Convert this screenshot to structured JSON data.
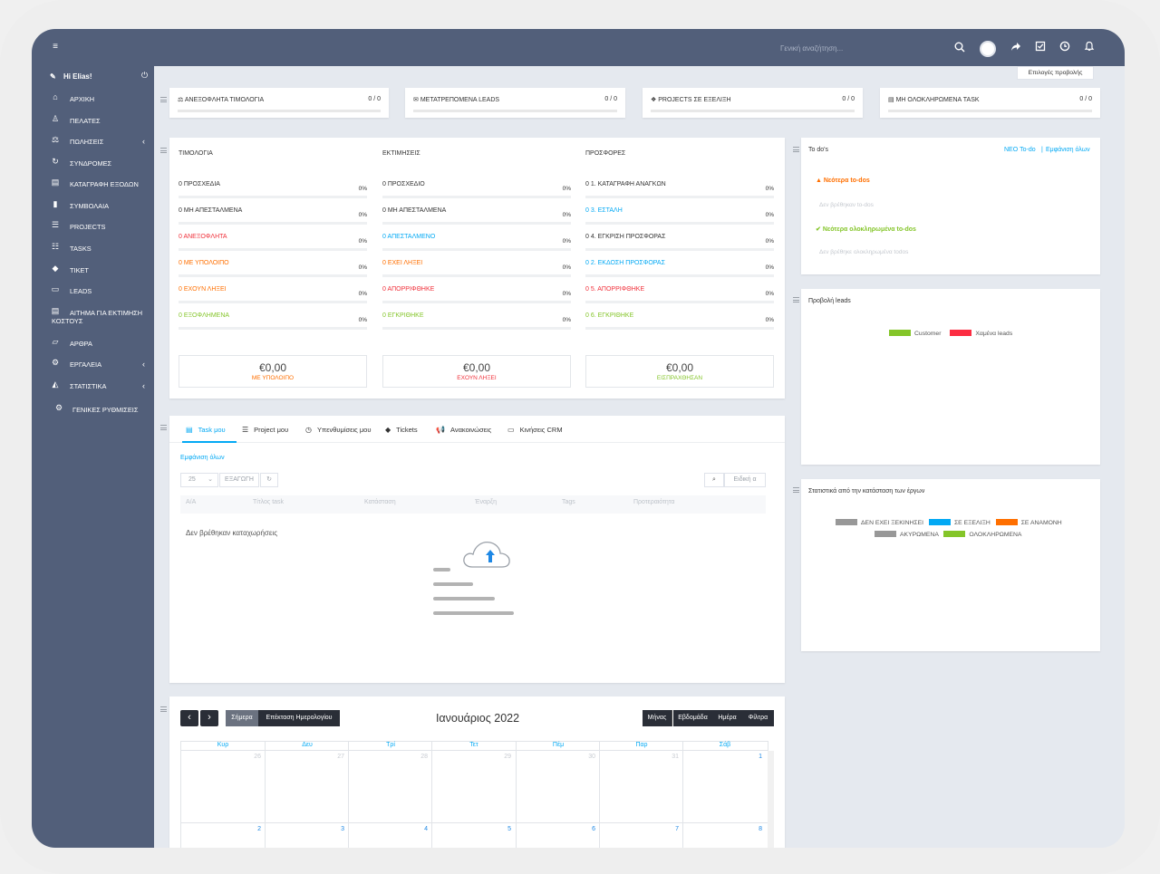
{
  "topbar": {
    "search_placeholder": "Γενική αναζήτηση...",
    "icons": [
      "menu-icon",
      "search-icon",
      "avatar",
      "share-icon",
      "checklist-icon",
      "clock-icon",
      "bell-icon"
    ]
  },
  "sidebar": {
    "greeting": "Hi Elias!",
    "items": [
      {
        "label": "ΑΡΧΙΚΗ",
        "icon": "home-icon"
      },
      {
        "label": "ΠΕΛΑΤΕΣ",
        "icon": "user-icon"
      },
      {
        "label": "ΠΩΛΗΣΕΙΣ",
        "icon": "balance-scale-icon",
        "chevron": true
      },
      {
        "label": "ΣΥΝΔΡΟΜΕΣ",
        "icon": "refresh-icon"
      },
      {
        "label": "ΚΑΤΑΓΡΑΦΗ ΕΞΟΔΩΝ",
        "icon": "file-lines-icon"
      },
      {
        "label": "ΣΥΜΒΟΛΑΙΑ",
        "icon": "file-icon"
      },
      {
        "label": "PROJECTS",
        "icon": "bars-icon"
      },
      {
        "label": "TASKS",
        "icon": "list-icon"
      },
      {
        "label": "ΤΙΚΕΤ",
        "icon": "ticket-icon"
      },
      {
        "label": "LEADS",
        "icon": "tty-icon"
      },
      {
        "label": "ΑΙΤΗΜΑ ΓΙΑ ΕΚΤΙΜΗΣΗ",
        "label2": "ΚΟΣΤΟΥΣ",
        "icon": "file-alt-icon"
      },
      {
        "label": "ΑΡΘΡΑ",
        "icon": "folder-open-icon"
      },
      {
        "label": "ΕΡΓΑΛΕΙΑ",
        "icon": "cogs-icon",
        "chevron": true
      },
      {
        "label": "ΣΤΑΤΙΣΤΙΚΑ",
        "icon": "area-chart-icon",
        "chevron": true
      },
      {
        "label": "ΓΕΝΙΚΕΣ ΡΥΘΜΙΣΕΙΣ",
        "icon": "gear-icon"
      }
    ]
  },
  "view_options_label": "Επιλογές προβολής",
  "stats": [
    {
      "title": "ΑΝΕΞΟΦΛΗΤΑ ΤΙΜΟΛΟΓΙΑ",
      "count": "0 / 0",
      "icon": "balance-scale-icon"
    },
    {
      "title": "ΜΕΤΑΤΡΕΠΟΜΕΝΑ LEADS",
      "count": "0 / 0",
      "icon": "envelope-icon"
    },
    {
      "title": "PROJECTS ΣΕ ΕΞΕΛΙΞΗ",
      "count": "0 / 0",
      "icon": "cubes-icon"
    },
    {
      "title": "ΜΗ ΟΛΟΚΛΗΡΩΜΕΝΑ TASK",
      "count": "0 / 0",
      "icon": "tasks-icon"
    }
  ],
  "finance": {
    "columns": [
      {
        "title": "ΤΙΜΟΛΟΓΙΑ",
        "rows": [
          {
            "label": "0 ΠΡΟΣΧΕΔΙΑ",
            "pct": "0%",
            "color": "gray"
          },
          {
            "label": "0 ΜΗ ΑΠΕΣΤΑΛΜΕΝΑ",
            "pct": "0%",
            "color": "gray"
          },
          {
            "label": "0 ΑΝΕΞΟΦΛΗΤΑ",
            "pct": "0%",
            "color": "red"
          },
          {
            "label": "0 ΜΕ ΥΠΟΛΟΙΠΟ",
            "pct": "0%",
            "color": "orange"
          },
          {
            "label": "0 ΕΧΟΥΝ ΛΗΞΕΙ",
            "pct": "0%",
            "color": "orange"
          },
          {
            "label": "0 ΕΞΟΦΛΗΜΕΝΑ",
            "pct": "0%",
            "color": "green"
          }
        ],
        "total": {
          "value": "€0,00",
          "label": "ΜΕ ΥΠΟΛΟΙΠΟ",
          "color": "orange"
        }
      },
      {
        "title": "ΕΚΤΙΜΗΣΕΙΣ",
        "rows": [
          {
            "label": "0 ΠΡΟΣΧΕΔΙΟ",
            "pct": "0%",
            "color": "gray"
          },
          {
            "label": "0 ΜΗ ΑΠΕΣΤΑΛΜΕΝΑ",
            "pct": "0%",
            "color": "gray"
          },
          {
            "label": "0 ΑΠΕΣΤΑΛΜΕΝΟ",
            "pct": "0%",
            "color": "blue"
          },
          {
            "label": "0 ΕΧΕΙ ΛΗΞΕΙ",
            "pct": "0%",
            "color": "orange"
          },
          {
            "label": "0 ΑΠΟΡΡΙΦΘΗΚΕ",
            "pct": "0%",
            "color": "red"
          },
          {
            "label": "0 ΕΓΚΡΙΘΗΚΕ",
            "pct": "0%",
            "color": "green"
          }
        ],
        "total": {
          "value": "€0,00",
          "label": "ΕΧΟΥΝ ΛΗΞΕΙ",
          "color": "red"
        }
      },
      {
        "title": "ΠΡΟΣΦΟΡΕΣ",
        "rows": [
          {
            "label": "0 1. ΚΑΤΑΓΡΑΦΗ ΑΝΑΓΚΩΝ",
            "pct": "0%",
            "color": "gray"
          },
          {
            "label": "0 3. ΕΣΤΑΛΗ",
            "pct": "0%",
            "color": "blue"
          },
          {
            "label": "0 4. ΕΓΚΡΙΣΗ ΠΡΟΣΦΟΡΑΣ",
            "pct": "0%",
            "color": "gray"
          },
          {
            "label": "0 2. ΕΚΔΟΣΗ ΠΡΟΣΦΟΡΑΣ",
            "pct": "0%",
            "color": "blue"
          },
          {
            "label": "0 5. ΑΠΟΡΡΙΦΘΗΚΕ",
            "pct": "0%",
            "color": "red"
          },
          {
            "label": "0 6. ΕΓΚΡΙΘΗΚΕ",
            "pct": "0%",
            "color": "green"
          }
        ],
        "total": {
          "value": "€0,00",
          "label": "ΕΙΣΠΡΑΧΘΗΣΑΝ",
          "color": "green"
        }
      }
    ]
  },
  "todos": {
    "title": "To do's",
    "new_link": "ΝΕΟ To-do",
    "sep": "|",
    "view_all": "Εμφάνιση όλων",
    "latest": "Νεότερα to-dos",
    "none_latest": "Δεν βρέθηκαν to-dos",
    "latest_done": "Νεότερα ολοκληρωμένα to-dos",
    "none_done": "Δεν βρέθηκε ολοκληρωμένα todos"
  },
  "leads_panel": {
    "title": "Προβολή leads",
    "legend": [
      {
        "name": "Customer",
        "color": "#84c529"
      },
      {
        "name": "Χαμένα leads",
        "color": "#fc2d42"
      }
    ]
  },
  "projects_panel": {
    "title": "Στατιστικά από την κατάσταση των έργων",
    "legend": [
      {
        "name": "ΔΕΝ ΕΧΕΙ ΞΕΚΙΝΗΣΕΙ",
        "color": "#989898"
      },
      {
        "name": "ΣΕ ΕΞΕΛΙΞΗ",
        "color": "#03a9f4"
      },
      {
        "name": "ΣΕ ΑΝΑΜΟΝΗ",
        "color": "#ff6f00"
      },
      {
        "name": "ΑΚΥΡΩΜΕΝΑ",
        "color": "#989898"
      },
      {
        "name": "ΟΛΟΚΛΗΡΩΜΕΝΑ",
        "color": "#84c529"
      }
    ]
  },
  "tasks_panel": {
    "tabs": [
      {
        "label": "Task μου",
        "icon": "tasks-icon"
      },
      {
        "label": "Project μου",
        "icon": "bars-icon"
      },
      {
        "label": "Υπενθυμίσεις μου",
        "icon": "clock-icon"
      },
      {
        "label": "Tickets",
        "icon": "ticket-icon"
      },
      {
        "label": "Ανακοινώσεις",
        "icon": "bullhorn-icon"
      },
      {
        "label": "Κινήσεις CRM",
        "icon": "window-icon"
      }
    ],
    "view_all": "Εμφάνιση όλων",
    "page_size": "25",
    "export": "ΕΞΑΓΩΓΗ",
    "search_placeholder": "Ειδική α",
    "columns": [
      "Α/Α",
      "Τίτλος task",
      "Κατάσταση",
      "Έναρξη",
      "Tags",
      "Προτεραιότητα"
    ],
    "empty": "Δεν βρέθηκαν καταχωρήσεις"
  },
  "calendar": {
    "today": "Σήμερα",
    "expand": "Επέκταση Ημερολογίου",
    "title": "Ιανουάριος 2022",
    "views": [
      "Μήνας",
      "Εβδομάδα",
      "Ημέρα",
      "Φίλτρα"
    ],
    "days": [
      "Κυρ",
      "Δευ",
      "Τρί",
      "Τετ",
      "Πέμ",
      "Παρ",
      "Σάβ"
    ],
    "week1": [
      "26",
      "27",
      "28",
      "29",
      "30",
      "31",
      "1"
    ],
    "week2": [
      "2",
      "3",
      "4",
      "5",
      "6",
      "7",
      "8"
    ]
  }
}
